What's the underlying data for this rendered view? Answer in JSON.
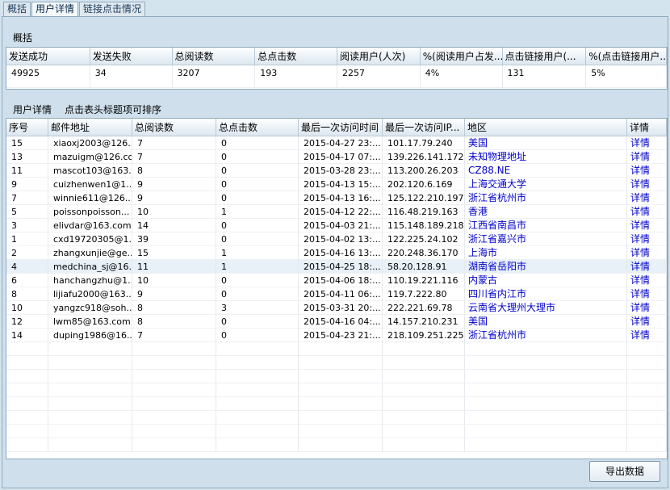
{
  "tabs": [
    "概括",
    "用户详情",
    "链接点击情况"
  ],
  "summary": {
    "title": "概括",
    "headers": [
      "发送成功",
      "发送失败",
      "总阅读数",
      "总点击数",
      "阅读用户(人次)",
      "%(阅读用户占发...",
      "点击链接用户(...",
      "%(点击链接用户..."
    ],
    "values": [
      "49925",
      "34",
      "3207",
      "193",
      "2257",
      "4%",
      "131",
      "5%"
    ]
  },
  "details": {
    "title": "用户详情",
    "hint": "点击表头标题项可排序",
    "headers": [
      "序号",
      "邮件地址",
      "总阅读数",
      "总点击数",
      "最后一次访问时间",
      "最后一次访问IP...",
      "地区",
      "详情"
    ],
    "rows": [
      [
        "15",
        "xiaoxj2003@126....",
        "7",
        "0",
        "2015-04-27 23:...",
        "101.17.79.240",
        "美国",
        "详情"
      ],
      [
        "13",
        "mazuigm@126.com",
        "7",
        "0",
        "2015-04-17 07:...",
        "139.226.141.172",
        "未知物理地址",
        "详情"
      ],
      [
        "11",
        "mascot103@163....",
        "8",
        "0",
        "2015-03-28 23:...",
        "113.200.26.203",
        "CZ88.NE",
        "详情"
      ],
      [
        "9",
        "cuizhenwen1@1...",
        "9",
        "0",
        "2015-04-13 15:...",
        "202.120.6.169",
        "上海交通大学",
        "详情"
      ],
      [
        "7",
        "winnie611@126....",
        "9",
        "0",
        "2015-04-13 16:...",
        "125.122.210.197",
        "浙江省杭州市",
        "详情"
      ],
      [
        "5",
        "poissonpoisson...",
        "10",
        "1",
        "2015-04-12 22:...",
        "116.48.219.163",
        "香港",
        "详情"
      ],
      [
        "3",
        "elivdar@163.com",
        "14",
        "0",
        "2015-04-03 21:...",
        "115.148.189.218",
        "江西省南昌市",
        "详情"
      ],
      [
        "1",
        "cxd19720305@1...",
        "39",
        "0",
        "2015-04-02 13:...",
        "122.225.24.102",
        "浙江省嘉兴市",
        "详情"
      ],
      [
        "2",
        "zhangxunjie@ge...",
        "15",
        "1",
        "2015-04-16 13:...",
        "220.248.36.170",
        "上海市",
        "详情"
      ],
      [
        "4",
        "medchina_sj@16...",
        "11",
        "1",
        "2015-04-25 18:...",
        "58.20.128.91",
        "湖南省岳阳市",
        "详情"
      ],
      [
        "6",
        "hanchangzhu@1...",
        "10",
        "0",
        "2015-04-06 18:...",
        "110.19.221.116",
        "内蒙古",
        "详情"
      ],
      [
        "8",
        "lijiafu2000@163....",
        "9",
        "0",
        "2015-04-11 06:...",
        "119.7.222.80",
        "四川省内江市",
        "详情"
      ],
      [
        "10",
        "yangzc918@soh...",
        "8",
        "3",
        "2015-03-31 20:...",
        "222.221.69.78",
        "云南省大理州大理市",
        "详情"
      ],
      [
        "12",
        "lwm85@163.com",
        "8",
        "0",
        "2015-04-16 04:...",
        "14.157.210.231",
        "美国",
        "详情"
      ],
      [
        "14",
        "duping1986@16...",
        "7",
        "0",
        "2015-04-23 21:...",
        "218.109.251.225",
        "浙江省杭州市",
        "详情"
      ]
    ]
  },
  "export_label": "导出数据"
}
